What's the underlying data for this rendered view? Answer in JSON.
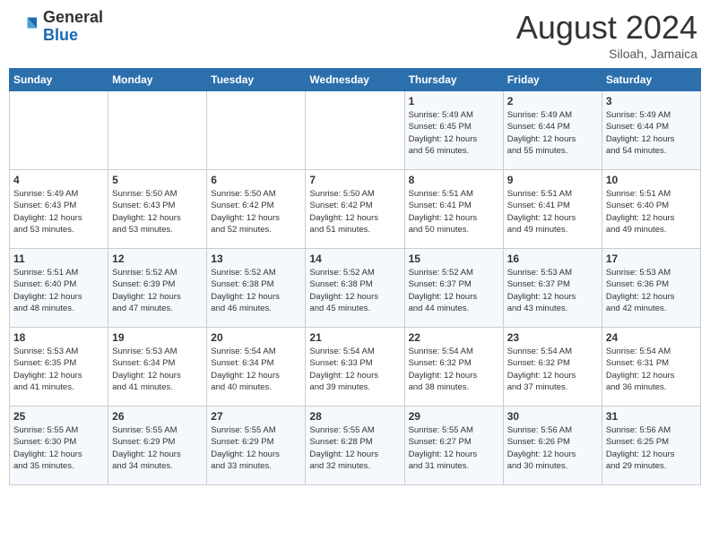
{
  "header": {
    "logo_general": "General",
    "logo_blue": "Blue",
    "title": "August 2024",
    "subtitle": "Siloah, Jamaica"
  },
  "weekdays": [
    "Sunday",
    "Monday",
    "Tuesday",
    "Wednesday",
    "Thursday",
    "Friday",
    "Saturday"
  ],
  "weeks": [
    [
      {
        "day": "",
        "info": ""
      },
      {
        "day": "",
        "info": ""
      },
      {
        "day": "",
        "info": ""
      },
      {
        "day": "",
        "info": ""
      },
      {
        "day": "1",
        "info": "Sunrise: 5:49 AM\nSunset: 6:45 PM\nDaylight: 12 hours\nand 56 minutes."
      },
      {
        "day": "2",
        "info": "Sunrise: 5:49 AM\nSunset: 6:44 PM\nDaylight: 12 hours\nand 55 minutes."
      },
      {
        "day": "3",
        "info": "Sunrise: 5:49 AM\nSunset: 6:44 PM\nDaylight: 12 hours\nand 54 minutes."
      }
    ],
    [
      {
        "day": "4",
        "info": "Sunrise: 5:49 AM\nSunset: 6:43 PM\nDaylight: 12 hours\nand 53 minutes."
      },
      {
        "day": "5",
        "info": "Sunrise: 5:50 AM\nSunset: 6:43 PM\nDaylight: 12 hours\nand 53 minutes."
      },
      {
        "day": "6",
        "info": "Sunrise: 5:50 AM\nSunset: 6:42 PM\nDaylight: 12 hours\nand 52 minutes."
      },
      {
        "day": "7",
        "info": "Sunrise: 5:50 AM\nSunset: 6:42 PM\nDaylight: 12 hours\nand 51 minutes."
      },
      {
        "day": "8",
        "info": "Sunrise: 5:51 AM\nSunset: 6:41 PM\nDaylight: 12 hours\nand 50 minutes."
      },
      {
        "day": "9",
        "info": "Sunrise: 5:51 AM\nSunset: 6:41 PM\nDaylight: 12 hours\nand 49 minutes."
      },
      {
        "day": "10",
        "info": "Sunrise: 5:51 AM\nSunset: 6:40 PM\nDaylight: 12 hours\nand 49 minutes."
      }
    ],
    [
      {
        "day": "11",
        "info": "Sunrise: 5:51 AM\nSunset: 6:40 PM\nDaylight: 12 hours\nand 48 minutes."
      },
      {
        "day": "12",
        "info": "Sunrise: 5:52 AM\nSunset: 6:39 PM\nDaylight: 12 hours\nand 47 minutes."
      },
      {
        "day": "13",
        "info": "Sunrise: 5:52 AM\nSunset: 6:38 PM\nDaylight: 12 hours\nand 46 minutes."
      },
      {
        "day": "14",
        "info": "Sunrise: 5:52 AM\nSunset: 6:38 PM\nDaylight: 12 hours\nand 45 minutes."
      },
      {
        "day": "15",
        "info": "Sunrise: 5:52 AM\nSunset: 6:37 PM\nDaylight: 12 hours\nand 44 minutes."
      },
      {
        "day": "16",
        "info": "Sunrise: 5:53 AM\nSunset: 6:37 PM\nDaylight: 12 hours\nand 43 minutes."
      },
      {
        "day": "17",
        "info": "Sunrise: 5:53 AM\nSunset: 6:36 PM\nDaylight: 12 hours\nand 42 minutes."
      }
    ],
    [
      {
        "day": "18",
        "info": "Sunrise: 5:53 AM\nSunset: 6:35 PM\nDaylight: 12 hours\nand 41 minutes."
      },
      {
        "day": "19",
        "info": "Sunrise: 5:53 AM\nSunset: 6:34 PM\nDaylight: 12 hours\nand 41 minutes."
      },
      {
        "day": "20",
        "info": "Sunrise: 5:54 AM\nSunset: 6:34 PM\nDaylight: 12 hours\nand 40 minutes."
      },
      {
        "day": "21",
        "info": "Sunrise: 5:54 AM\nSunset: 6:33 PM\nDaylight: 12 hours\nand 39 minutes."
      },
      {
        "day": "22",
        "info": "Sunrise: 5:54 AM\nSunset: 6:32 PM\nDaylight: 12 hours\nand 38 minutes."
      },
      {
        "day": "23",
        "info": "Sunrise: 5:54 AM\nSunset: 6:32 PM\nDaylight: 12 hours\nand 37 minutes."
      },
      {
        "day": "24",
        "info": "Sunrise: 5:54 AM\nSunset: 6:31 PM\nDaylight: 12 hours\nand 36 minutes."
      }
    ],
    [
      {
        "day": "25",
        "info": "Sunrise: 5:55 AM\nSunset: 6:30 PM\nDaylight: 12 hours\nand 35 minutes."
      },
      {
        "day": "26",
        "info": "Sunrise: 5:55 AM\nSunset: 6:29 PM\nDaylight: 12 hours\nand 34 minutes."
      },
      {
        "day": "27",
        "info": "Sunrise: 5:55 AM\nSunset: 6:29 PM\nDaylight: 12 hours\nand 33 minutes."
      },
      {
        "day": "28",
        "info": "Sunrise: 5:55 AM\nSunset: 6:28 PM\nDaylight: 12 hours\nand 32 minutes."
      },
      {
        "day": "29",
        "info": "Sunrise: 5:55 AM\nSunset: 6:27 PM\nDaylight: 12 hours\nand 31 minutes."
      },
      {
        "day": "30",
        "info": "Sunrise: 5:56 AM\nSunset: 6:26 PM\nDaylight: 12 hours\nand 30 minutes."
      },
      {
        "day": "31",
        "info": "Sunrise: 5:56 AM\nSunset: 6:25 PM\nDaylight: 12 hours\nand 29 minutes."
      }
    ]
  ]
}
